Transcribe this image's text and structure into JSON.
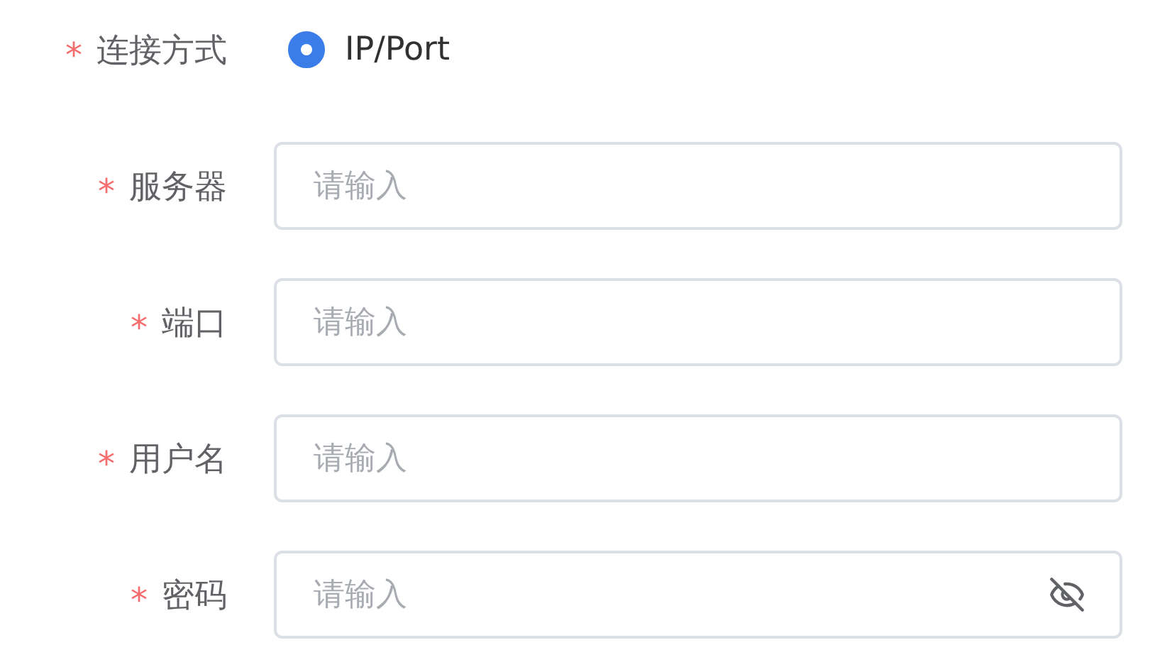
{
  "connection": {
    "label": "连接方式",
    "required_mark": "*",
    "options": [
      {
        "label": "IP/Port",
        "selected": true
      }
    ]
  },
  "fields": [
    {
      "label": "服务器",
      "required_mark": "*",
      "placeholder": "请输入",
      "kind": "text"
    },
    {
      "label": "端口",
      "required_mark": "*",
      "placeholder": "请输入",
      "kind": "text"
    },
    {
      "label": "用户名",
      "required_mark": "*",
      "placeholder": "请输入",
      "kind": "text"
    },
    {
      "label": "密码",
      "required_mark": "*",
      "placeholder": "请输入",
      "kind": "password"
    }
  ]
}
